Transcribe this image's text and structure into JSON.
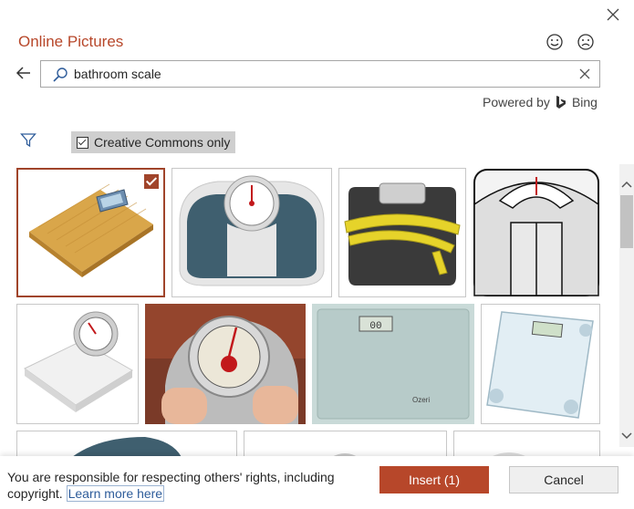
{
  "dialog": {
    "title": "Online Pictures",
    "close_icon": "close-icon",
    "feedback_icons": [
      "smile-icon",
      "frown-icon"
    ]
  },
  "search": {
    "value": "bathroom scale",
    "placeholder": "",
    "powered_by_label": "Powered by",
    "engine_name": "Bing"
  },
  "filters": {
    "creative_commons_label": "Creative Commons only",
    "creative_commons_checked": true
  },
  "results": [
    {
      "id": "scale-bamboo-digital",
      "selected": true
    },
    {
      "id": "scale-analog-blue-gray",
      "selected": false
    },
    {
      "id": "scale-tape-measure",
      "selected": false
    },
    {
      "id": "scale-white-illustration",
      "selected": false
    },
    {
      "id": "scale-white-round-dial",
      "selected": false
    },
    {
      "id": "scale-feet-photo",
      "selected": false
    },
    {
      "id": "scale-glass-digital",
      "selected": false
    },
    {
      "id": "scale-glass-tilted",
      "selected": false
    },
    {
      "id": "scale-partial-1",
      "selected": false
    },
    {
      "id": "scale-partial-2",
      "selected": false
    },
    {
      "id": "scale-partial-3",
      "selected": false
    }
  ],
  "footer": {
    "note_text": "You are responsible for respecting others' rights, including copyright.",
    "learn_more_label": "Learn more here",
    "insert_label": "Insert (1)",
    "cancel_label": "Cancel"
  },
  "colors": {
    "accent": "#b7472a",
    "selection_border": "#a0442a",
    "link": "#2e5c9a"
  }
}
